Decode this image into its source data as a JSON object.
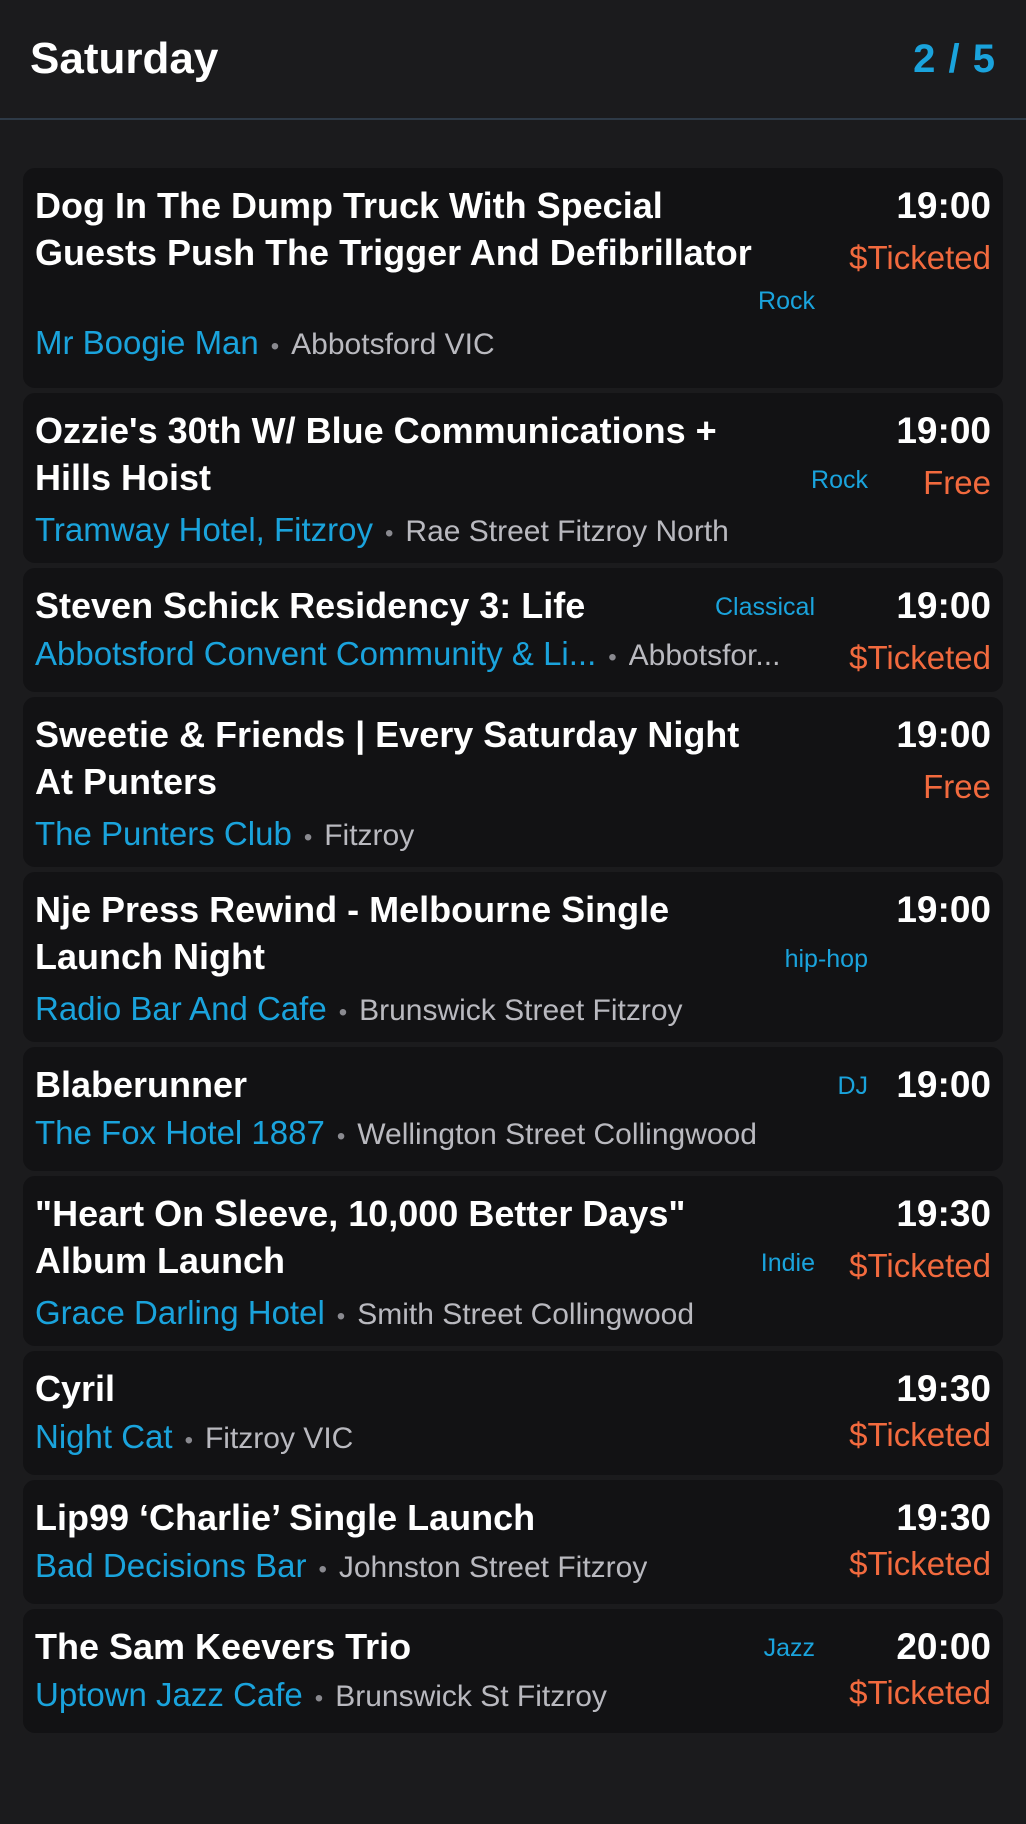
{
  "header": {
    "title": "Saturday",
    "pager": "2 / 5"
  },
  "events": [
    {
      "title": "Dog In The Dump Truck With Special Guests Push The Trigger And Defibrillator",
      "time": "19:00",
      "price": "$Ticketed",
      "genre": "Rock",
      "venue": "Mr Boogie Man",
      "location": "Abbotsford VIC"
    },
    {
      "title": "Ozzie's 30th W/ Blue Communications + Hills Hoist",
      "time": "19:00",
      "price": "Free",
      "genre": "Rock",
      "venue": "Tramway Hotel, Fitzroy",
      "location": "Rae Street Fitzroy North"
    },
    {
      "title": "Steven Schick Residency 3: Life",
      "time": "19:00",
      "price": "$Ticketed",
      "genre": "Classical",
      "venue": "Abbotsford Convent Community & Li...",
      "location": "Abbotsfor..."
    },
    {
      "title": "Sweetie & Friends | Every Saturday Night At Punters",
      "time": "19:00",
      "price": "Free",
      "genre": "",
      "venue": "The Punters Club",
      "location": "Fitzroy"
    },
    {
      "title": "Nje Press Rewind - Melbourne Single Launch Night",
      "time": "19:00",
      "price": "",
      "genre": "hip-hop",
      "venue": "Radio Bar And Cafe",
      "location": "Brunswick Street Fitzroy"
    },
    {
      "title": "Blaberunner",
      "time": "19:00",
      "price": "",
      "genre": "DJ",
      "venue": "The Fox Hotel 1887",
      "location": "Wellington Street Collingwood"
    },
    {
      "title": "\"Heart On Sleeve, 10,000 Better Days\" Album Launch",
      "time": "19:30",
      "price": "$Ticketed",
      "genre": "Indie",
      "venue": "Grace Darling Hotel",
      "location": "Smith Street Collingwood"
    },
    {
      "title": "Cyril",
      "time": "19:30",
      "price": "$Ticketed",
      "genre": "",
      "venue": "Night Cat",
      "location": "Fitzroy VIC"
    },
    {
      "title": "Lip99 ‘Charlie’ Single Launch",
      "time": "19:30",
      "price": "$Ticketed",
      "genre": "",
      "venue": "Bad Decisions Bar",
      "location": "Johnston Street Fitzroy"
    },
    {
      "title": "The Sam Keevers Trio",
      "time": "20:00",
      "price": "$Ticketed",
      "genre": "Jazz",
      "venue": "Uptown Jazz Cafe",
      "location": "Brunswick St Fitzroy"
    }
  ],
  "separator": "•",
  "colors": {
    "accent": "#1aa3dc",
    "price": "#f26a3e",
    "background": "#1b1b1d",
    "card": "#121214"
  }
}
